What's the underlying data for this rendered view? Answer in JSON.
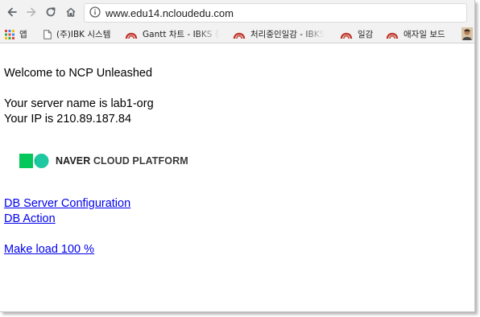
{
  "browser": {
    "address_bar": {
      "url": "www.edu14.ncloudedu.com"
    },
    "bookmarks": [
      {
        "label": "앱",
        "icon": "apps-grid-icon"
      },
      {
        "label": "(주)IBK 시스템",
        "icon": "page-icon"
      },
      {
        "label": "Gantt 차트 - IBKS 통",
        "icon": "arch-favicon-icon"
      },
      {
        "label": "처리중인일감 - IBKS",
        "icon": "arch-favicon-icon"
      },
      {
        "label": "일감",
        "icon": "arch-favicon-icon"
      },
      {
        "label": "애자일 보드",
        "icon": "arch-favicon-icon"
      },
      {
        "label": "",
        "icon": "avatar-icon"
      }
    ]
  },
  "page": {
    "welcome": "Welcome to NCP Unleashed",
    "server_name": "Your server name is lab1-org",
    "ip": "Your IP is 210.89.187.84",
    "logo": {
      "text_bold": "NAVER",
      "text_rest": "CLOUD PLATFORM",
      "colors": [
        "#03c75a",
        "#1ec8a0"
      ]
    },
    "links": {
      "db_config": "DB Server Configuration",
      "db_action": "DB Action",
      "make_load": "Make load 100 %"
    }
  },
  "colors": {
    "link": "#0000ee",
    "toolbar_bg": "#f2f2f2",
    "favicon_red": "#c0362c"
  }
}
